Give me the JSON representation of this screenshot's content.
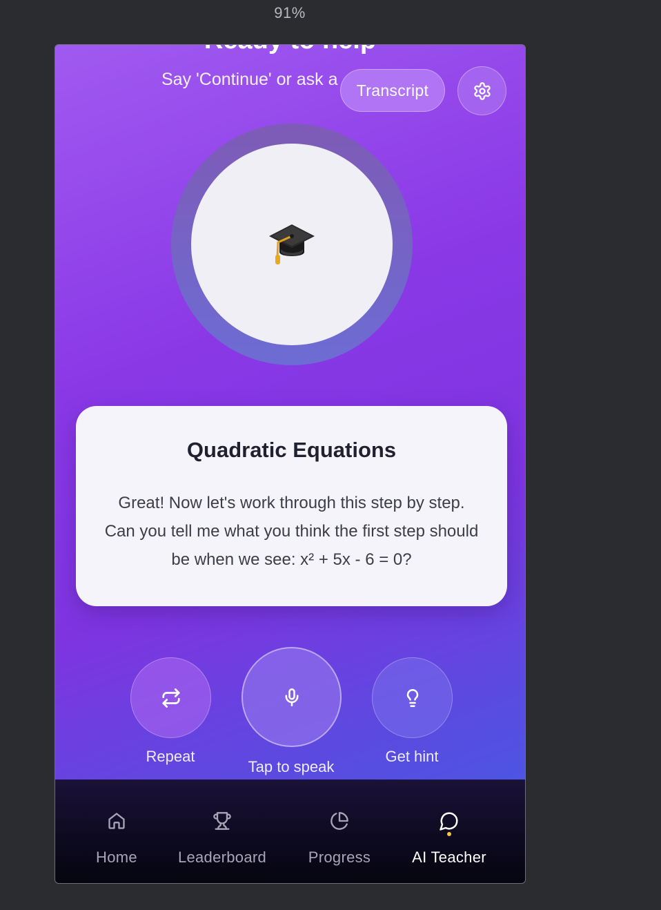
{
  "browser": {
    "zoom": "91%"
  },
  "status": {
    "title": "Ready to help",
    "subtitle": "Say 'Continue' or ask a"
  },
  "header": {
    "transcript_label": "Transcript",
    "settings_icon": "gear-icon"
  },
  "avatar": {
    "emoji": "🎓",
    "icon": "graduation-cap-icon"
  },
  "lesson": {
    "title": "Quadratic Equations",
    "message": "Great! Now let's work through this step by step. Can you tell me what you think the first step should be when we see: x² + 5x - 6 = 0?"
  },
  "actions": {
    "repeat_label": "Repeat",
    "speak_label": "Tap to speak",
    "hint_label": "Get hint"
  },
  "nav": {
    "items": [
      {
        "label": "Home",
        "icon": "home-icon"
      },
      {
        "label": "Leaderboard",
        "icon": "trophy-icon"
      },
      {
        "label": "Progress",
        "icon": "pie-chart-icon"
      },
      {
        "label": "AI Teacher",
        "icon": "chat-bubble-icon",
        "active": true
      }
    ]
  },
  "colors": {
    "gradient_start": "#a05af0",
    "gradient_end": "#3f5fe6",
    "active_dot": "#f7c545",
    "nav_background": "#0e0b22"
  }
}
